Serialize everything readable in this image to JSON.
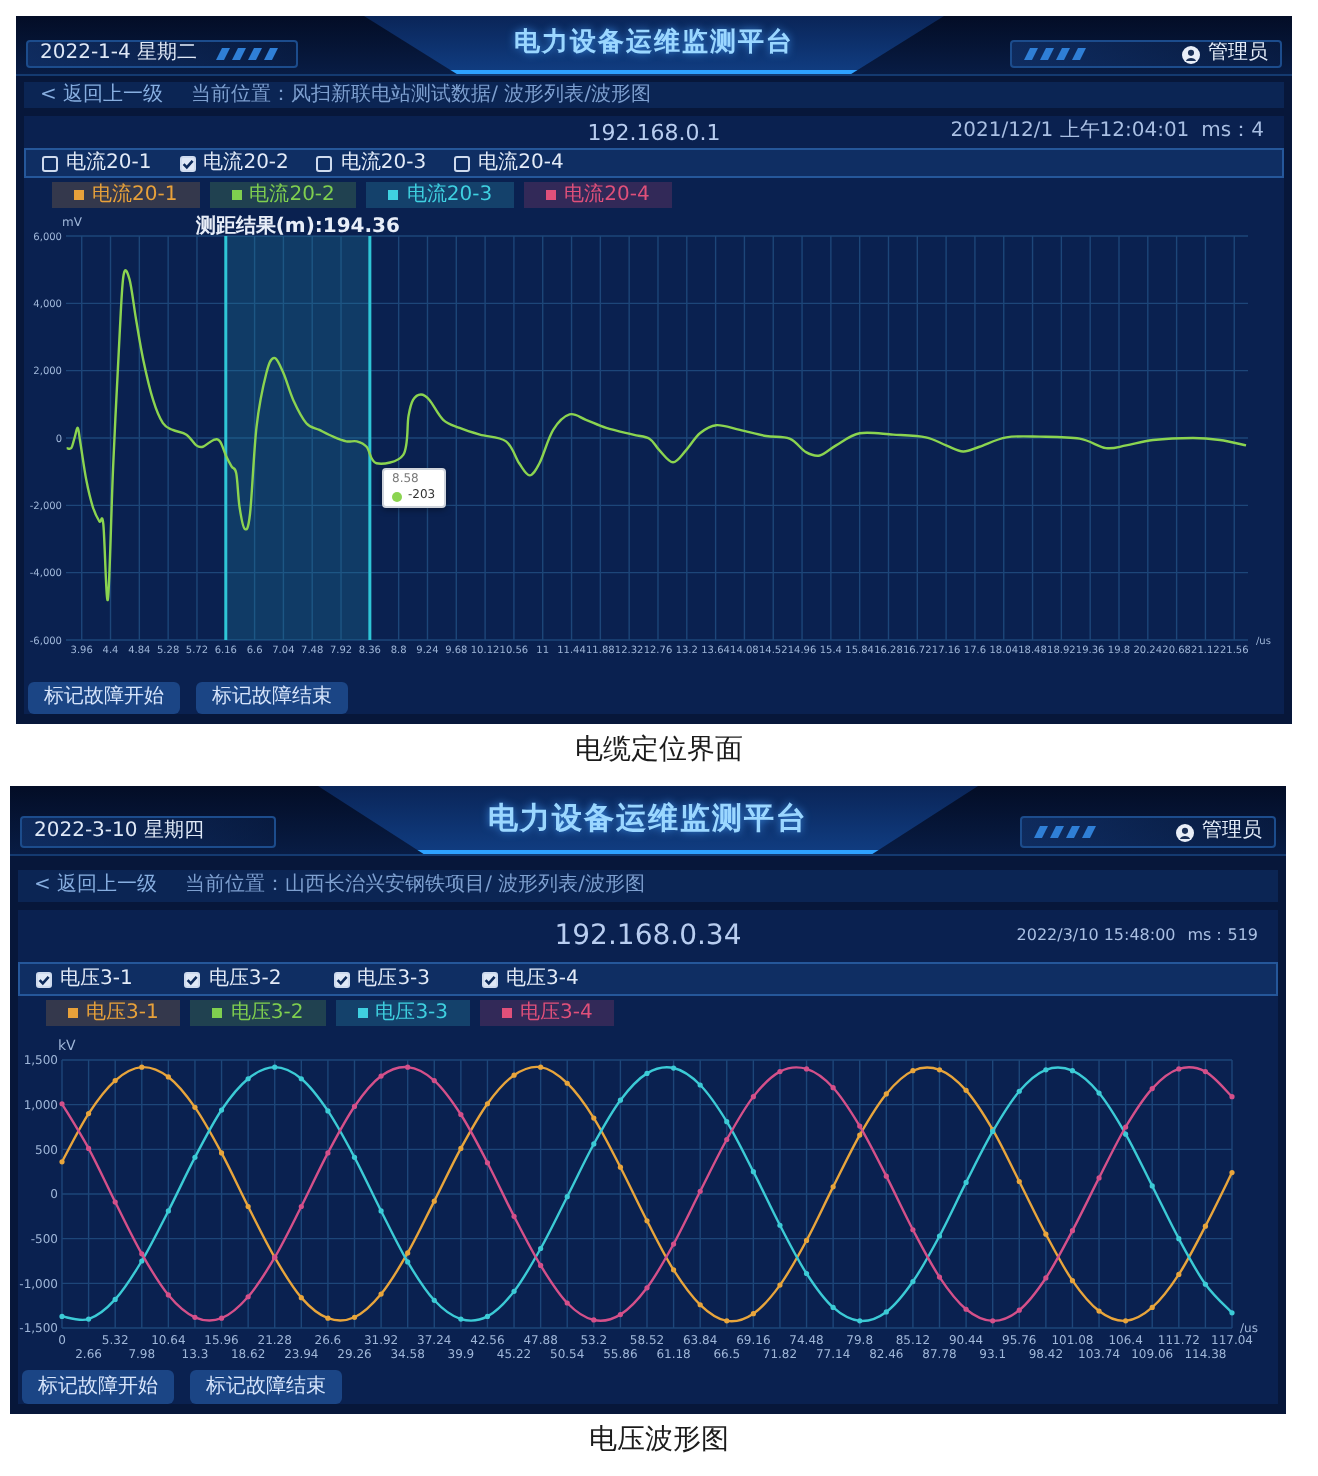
{
  "figures": [
    {
      "header": {
        "date": "2022-1-4 星期二",
        "title": "电力设备运维监测平台",
        "user": "管理员"
      },
      "breadcrumb": {
        "back": "< 返回上一级",
        "location": "当前位置：风扫新联电站测试数据/ 波形列表/波形图"
      },
      "device": {
        "ip": "192.168.0.1",
        "timestamp": "2021/12/1 上午12:04:01",
        "ms": "ms：4"
      },
      "channels": [
        {
          "label": "电流20-1",
          "checked": false
        },
        {
          "label": "电流20-2",
          "checked": true
        },
        {
          "label": "电流20-3",
          "checked": false
        },
        {
          "label": "电流20-4",
          "checked": false
        }
      ],
      "legend": [
        {
          "label": "电流20-1",
          "color": "#e8a13a"
        },
        {
          "label": "电流20-2",
          "color": "#7fcf4f"
        },
        {
          "label": "电流20-3",
          "color": "#3fd0e0"
        },
        {
          "label": "电流20-4",
          "color": "#e0507a"
        }
      ],
      "chart": {
        "chart_data": {
          "type": "line",
          "title": "测距结果(m):194.36",
          "ylabel": "mV",
          "xlabel": "/us",
          "grid": true,
          "x": [
            3.73,
            3.8,
            3.85,
            3.9,
            3.94,
            4.03,
            4.13,
            4.23,
            4.29,
            4.36,
            4.44,
            4.54,
            4.6,
            4.69,
            4.79,
            4.9,
            5.05,
            5.2,
            5.35,
            5.56,
            5.71,
            5.81,
            5.97,
            6.07,
            6.17,
            6.25,
            6.32,
            6.37,
            6.45,
            6.53,
            6.63,
            6.78,
            6.9,
            7.04,
            7.19,
            7.39,
            7.59,
            7.8,
            8.0,
            8.16,
            8.31,
            8.46,
            8.87,
            8.95,
            9.02,
            9.14,
            9.27,
            9.48,
            9.73,
            10.04,
            10.44,
            10.64,
            10.8,
            10.95,
            11.16,
            11.41,
            11.66,
            11.97,
            12.38,
            12.63,
            12.78,
            12.99,
            13.19,
            13.4,
            13.65,
            14.01,
            14.41,
            14.77,
            15.02,
            15.23,
            15.48,
            15.84,
            16.35,
            16.85,
            17.16,
            17.42,
            17.67,
            18.08,
            18.59,
            19.2,
            19.6,
            19.91,
            20.32,
            20.93,
            21.34,
            21.74
          ],
          "series": [
            {
              "color": "#8bd450",
              "values": [
                -300,
                -300,
                0,
                300,
                -150,
                -1250,
                -2050,
                -2480,
                -2560,
                -4790,
                -850,
                3120,
                4850,
                4710,
                3520,
                2320,
                1130,
                440,
                240,
                100,
                -220,
                -260,
                -60,
                -100,
                -560,
                -850,
                -1050,
                -2050,
                -2700,
                -2250,
                340,
                1930,
                2380,
                1930,
                1130,
                440,
                240,
                40,
                -100,
                -100,
                -260,
                -750,
                -500,
                650,
                1130,
                1290,
                1130,
                540,
                300,
                100,
                -100,
                -750,
                -1110,
                -750,
                240,
                700,
                540,
                300,
                100,
                -20,
                -360,
                -720,
                -360,
                140,
                380,
                240,
                60,
                -20,
                -420,
                -520,
                -220,
                140,
                100,
                20,
                -220,
                -400,
                -260,
                20,
                40,
                -20,
                -300,
                -220,
                -60,
                0,
                -60,
                -220
              ]
            }
          ],
          "xlim": [
            3.72,
            21.77
          ],
          "ylim": [
            -6000,
            6000
          ],
          "xticks": [
            3.96,
            4.4,
            4.84,
            5.28,
            5.72,
            6.16,
            6.6,
            7.04,
            7.48,
            7.92,
            8.36,
            8.8,
            9.24,
            9.68,
            10.12,
            10.56,
            11,
            11.44,
            11.88,
            12.32,
            12.76,
            13.2,
            13.64,
            14.08,
            14.52,
            14.96,
            15.4,
            15.84,
            16.28,
            16.72,
            17.16,
            17.6,
            18.04,
            18.48,
            18.92,
            19.36,
            19.8,
            20.24,
            20.68,
            21.12,
            21.56
          ],
          "yticks": [
            {
              "value": -6000,
              "label": "-6,000"
            },
            {
              "value": -4000,
              "label": "-4,000"
            },
            {
              "value": -2000,
              "label": "-2,000"
            },
            0,
            {
              "value": 2000,
              "label": "2,000"
            },
            {
              "value": 4000,
              "label": "4,000"
            },
            {
              "value": 6000,
              "label": "6,000"
            }
          ],
          "bands": [
            {
              "axis": "x",
              "from": 6.16,
              "to": 8.36
            }
          ],
          "ref_lines": [
            {
              "axis": "x",
              "value": 6.16
            },
            {
              "axis": "x",
              "value": 8.36
            }
          ]
        },
        "tooltip": {
          "title": "8.58",
          "value": "-203"
        }
      },
      "buttons": [
        "标记故障开始",
        "标记故障结束"
      ],
      "caption": "电缆定位界面"
    },
    {
      "header": {
        "date": "2022-3-10 星期四",
        "title": "电力设备运维监测平台",
        "user": "管理员"
      },
      "breadcrumb": {
        "back": "< 返回上一级",
        "location": "当前位置：山西长治兴安钢铁项目/ 波形列表/波形图"
      },
      "device": {
        "ip": "192.168.0.34",
        "timestamp": "2022/3/10 15:48:00",
        "ms": "ms：519"
      },
      "channels": [
        {
          "label": "电压3-1",
          "checked": true
        },
        {
          "label": "电压3-2",
          "checked": true
        },
        {
          "label": "电压3-3",
          "checked": true
        },
        {
          "label": "电压3-4",
          "checked": true
        }
      ],
      "legend": [
        {
          "label": "电压3-1",
          "color": "#e8a13a"
        },
        {
          "label": "电压3-2",
          "color": "#7fcf4f"
        },
        {
          "label": "电压3-3",
          "color": "#3fd0e0"
        },
        {
          "label": "电压3-4",
          "color": "#e0507a"
        }
      ],
      "chart": {
        "chart_data": {
          "type": "line",
          "ylabel": "kV",
          "xlabel": "/us",
          "grid": true,
          "categories": [
            "0",
            "2.66",
            "5.32",
            "7.98",
            "10.64",
            "13.3",
            "15.96",
            "18.62",
            "21.28",
            "23.94",
            "26.6",
            "29.26",
            "31.92",
            "34.58",
            "37.24",
            "39.9",
            "42.56",
            "45.22",
            "47.88",
            "50.54",
            "53.2",
            "55.86",
            "58.52",
            "61.18",
            "63.84",
            "66.5",
            "69.16",
            "71.82",
            "74.48",
            "77.14",
            "79.8",
            "82.46",
            "85.12",
            "87.78",
            "90.44",
            "93.1",
            "95.76",
            "98.42",
            "101.08",
            "103.74",
            "106.4",
            "109.06",
            "111.72",
            "114.38",
            "117.04"
          ],
          "series": [
            {
              "color": "#e8a53c",
              "values": [
                360,
                900,
                1270,
                1420,
                1310,
                970,
                460,
                -140,
                -710,
                -1160,
                -1390,
                -1380,
                -1120,
                -660,
                -80,
                510,
                1010,
                1330,
                1420,
                1240,
                850,
                300,
                -300,
                -850,
                -1240,
                -1420,
                -1340,
                -1020,
                -520,
                80,
                660,
                1120,
                1380,
                1390,
                1160,
                720,
                140,
                -450,
                -970,
                -1310,
                -1420,
                -1270,
                -900,
                -360,
                240
              ]
            },
            {
              "color": "#3ccbd6",
              "values": [
                -1370,
                -1400,
                -1180,
                -750,
                -190,
                410,
                940,
                1290,
                1420,
                1290,
                930,
                410,
                -190,
                -760,
                -1190,
                -1400,
                -1370,
                -1090,
                -610,
                -30,
                560,
                1050,
                1350,
                1410,
                1220,
                810,
                250,
                -350,
                -890,
                -1270,
                -1420,
                -1320,
                -980,
                -470,
                130,
                700,
                1150,
                1390,
                1380,
                1130,
                670,
                90,
                -500,
                -1010,
                -1330
              ]
            },
            {
              "color": "#d4508a",
              "values": [
                1010,
                510,
                -90,
                -670,
                -1130,
                -1380,
                -1390,
                -1150,
                -710,
                -140,
                460,
                980,
                1320,
                1420,
                1270,
                890,
                350,
                -250,
                -800,
                -1220,
                -1410,
                -1350,
                -1050,
                -560,
                30,
                610,
                1090,
                1370,
                1400,
                1190,
                760,
                200,
                -400,
                -930,
                -1290,
                -1420,
                -1300,
                -940,
                -410,
                180,
                750,
                1180,
                1400,
                1370,
                1090
              ]
            }
          ],
          "ylim": [
            -1500,
            1500
          ],
          "yticks": [
            {
              "value": -1500,
              "label": "-1,500"
            },
            {
              "value": -1000,
              "label": "-1,000"
            },
            -500,
            0,
            500,
            {
              "value": 1000,
              "label": "1,000"
            },
            {
              "value": 1500,
              "label": "1,500"
            }
          ]
        }
      },
      "buttons": [
        "标记故障开始",
        "标记故障结束"
      ],
      "caption": "电压波形图"
    }
  ]
}
